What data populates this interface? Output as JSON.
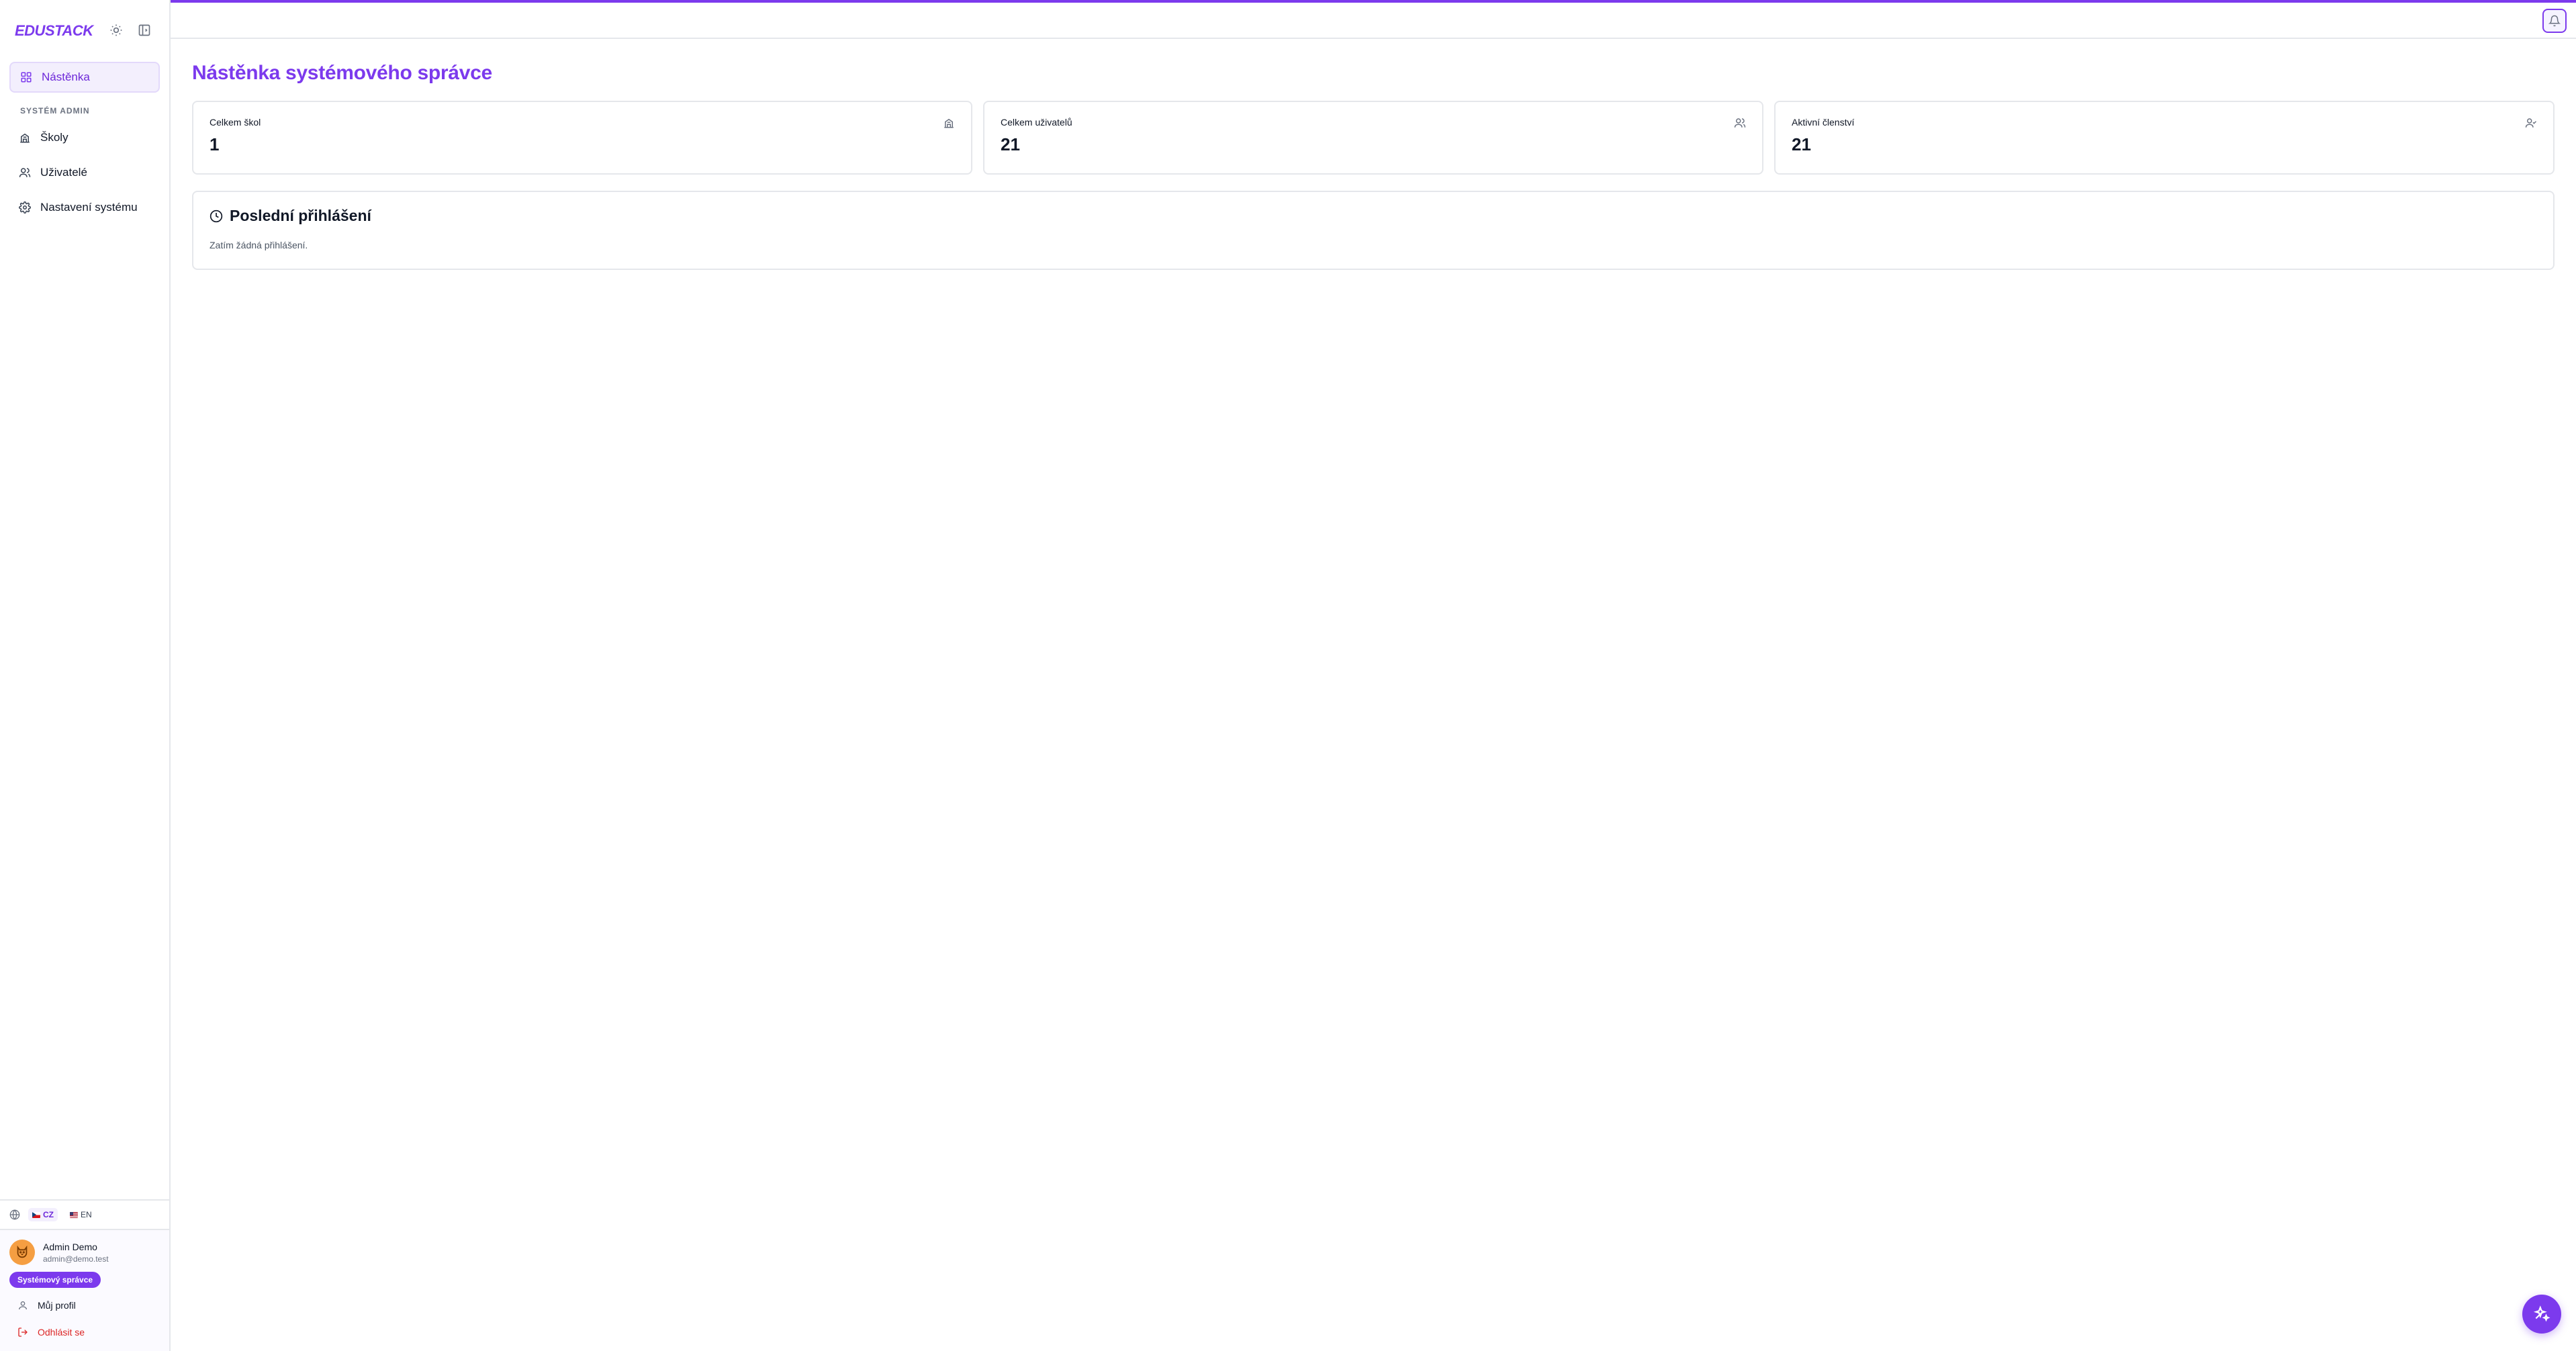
{
  "brand": {
    "logo": "EDUSTACK"
  },
  "sidebar": {
    "header_icons": [
      "sun-icon",
      "panel-toggle-icon"
    ],
    "items_top": [
      {
        "label": "Nástěnka",
        "icon": "grid-icon",
        "active": true
      }
    ],
    "section_label": "SYSTÉM ADMIN",
    "items": [
      {
        "label": "Školy",
        "icon": "school-icon"
      },
      {
        "label": "Uživatelé",
        "icon": "users-icon"
      },
      {
        "label": "Nastavení systému",
        "icon": "gear-icon"
      }
    ],
    "languages": [
      {
        "code": "CZ",
        "active": true
      },
      {
        "code": "EN",
        "active": false
      }
    ],
    "user": {
      "name": "Admin Demo",
      "email": "admin@demo.test",
      "role": "Systémový správce",
      "profile_label": "Můj profil",
      "logout_label": "Odhlásit se"
    }
  },
  "main": {
    "title": "Nástěnka systémového správce",
    "stats": [
      {
        "label": "Celkem škol",
        "value": "1",
        "icon": "school-icon"
      },
      {
        "label": "Celkem uživatelů",
        "value": "21",
        "icon": "users-icon"
      },
      {
        "label": "Aktivní členství",
        "value": "21",
        "icon": "user-check-icon"
      }
    ],
    "recent_logins": {
      "title": "Poslední přihlášení",
      "empty_text": "Zatím žádná přihlášení."
    }
  },
  "colors": {
    "accent": "#7c3aed",
    "logout": "#dc2626",
    "avatar": "#f59e42"
  }
}
